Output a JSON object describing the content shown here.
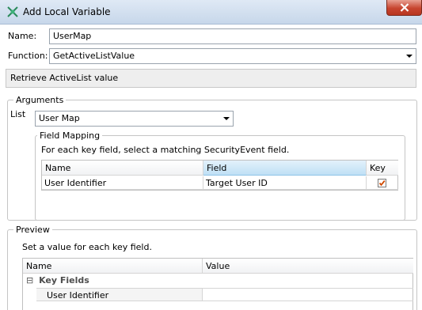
{
  "window": {
    "title": "Add Local Variable"
  },
  "form": {
    "name_label": "Name:",
    "name_value": "UserMap",
    "function_label": "Function:",
    "function_value": "GetActiveListValue",
    "description": "Retrieve ActiveList value"
  },
  "arguments": {
    "title": "Arguments",
    "list_label": "List",
    "list_value": "User Map",
    "field_mapping": {
      "title": "Field Mapping",
      "instruction": "For each key field, select a matching SecurityEvent field.",
      "columns": [
        "Name",
        "Field",
        "Key"
      ],
      "rows": [
        {
          "name": "User Identifier",
          "field": "Target User ID",
          "key": true
        }
      ]
    }
  },
  "preview": {
    "title": "Preview",
    "instruction": "Set a value for each key field.",
    "columns": [
      "Name",
      "Value"
    ],
    "group_label": "Key Fields",
    "group_toggle": "⊟",
    "rows": [
      {
        "name": "User Identifier",
        "value": ""
      }
    ]
  },
  "colors": {
    "titlebar": "#c7d7ea",
    "close_button": "#c7452f",
    "sorted_header": "#bfe0f5",
    "checkbox_mark": "#d04a02"
  },
  "icons": {
    "title": "variable-icon",
    "close": "close-icon",
    "checkbox": "checkbox-checked-icon",
    "dropdown": "chevron-down-icon"
  }
}
